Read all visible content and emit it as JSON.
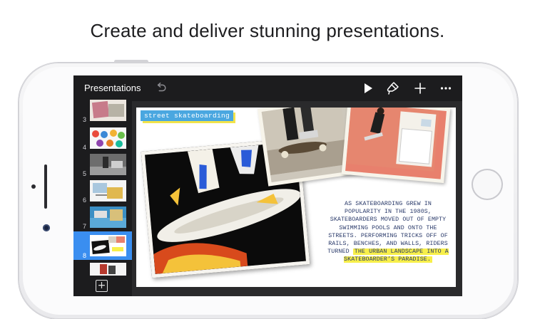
{
  "headline": "Create and deliver stunning presentations.",
  "toolbar": {
    "back_label": "Presentations",
    "undo_icon": "undo-arrow-icon",
    "play_icon": "play-icon",
    "format_icon": "paintbrush-icon",
    "add_icon": "plus-icon",
    "more_icon": "more-ellipsis-icon"
  },
  "navigator": {
    "slides": [
      {
        "number": "3"
      },
      {
        "number": "4"
      },
      {
        "number": "5"
      },
      {
        "number": "6"
      },
      {
        "number": "7"
      },
      {
        "number": "8",
        "selected": true
      },
      {
        "number": ""
      }
    ],
    "add_slide_icon": "add-slide-icon"
  },
  "slide": {
    "title": "street skateboarding",
    "body_plain": "AS SKATEBOARDING GREW IN POPULARITY IN THE 1980S, SKATEBOARDERS MOVED OUT OF EMPTY SWIMMING POOLS AND ONTO THE STREETS. PERFORMING TRICKS OFF OF RAILS, BENCHES, AND WALLS, RIDERS TURNED",
    "body_highlight": "THE URBAN LANDSCAPE INTO A SKATEBOARDER’S PARADISE."
  },
  "colors": {
    "accent": "#3a8ef0",
    "title_bg": "#4aa7e0",
    "title_shadow": "#f2e34a",
    "highlight": "#f7ef4a",
    "body_text": "#2a3a6a"
  }
}
